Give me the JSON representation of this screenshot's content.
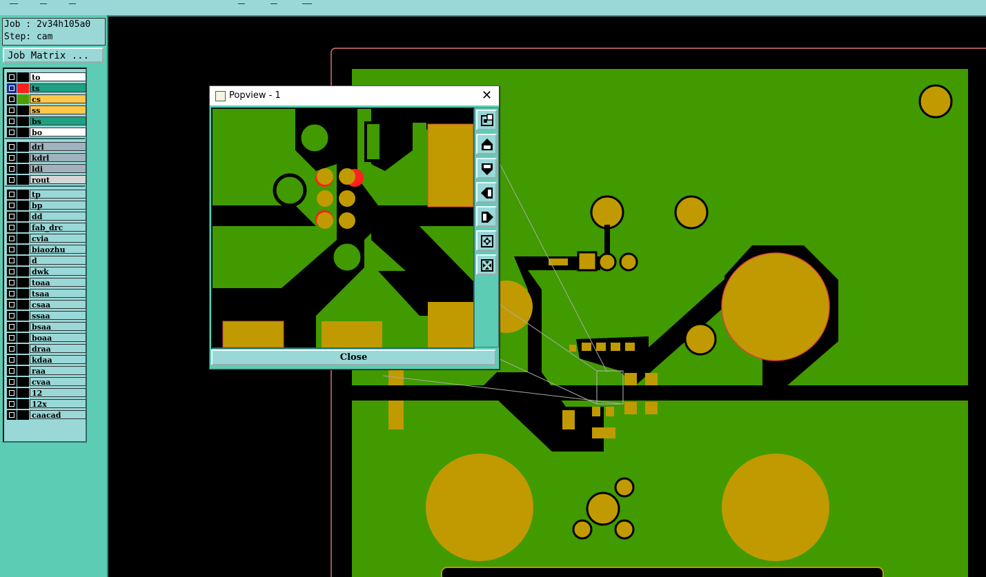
{
  "job": {
    "job_label": "Job : 2v34h105a0",
    "step_label": "Step: cam"
  },
  "job_matrix_label": "Job Matrix ...",
  "layers_board": [
    {
      "name": "to",
      "bg": "#ffffff",
      "selected": false,
      "color": "#000000"
    },
    {
      "name": "ts",
      "bg": "#1fa083",
      "selected": true,
      "color": "#ff2020"
    },
    {
      "name": "cs",
      "bg": "#ffc84a",
      "selected": false,
      "color": "#4aa000"
    },
    {
      "name": "ss",
      "bg": "#ffc84a",
      "selected": false,
      "color": "#000000"
    },
    {
      "name": "bs",
      "bg": "#1fa083",
      "selected": false,
      "color": "#000000"
    },
    {
      "name": "bo",
      "bg": "#ffffff",
      "selected": false,
      "color": "#000000"
    }
  ],
  "layers_drill": [
    {
      "name": "drl",
      "bg": "#9fb2bd"
    },
    {
      "name": "kdrl",
      "bg": "#9fb2bd"
    },
    {
      "name": "ldi",
      "bg": "#9fb2bd"
    },
    {
      "name": "rout",
      "bg": "#d6d6d6"
    }
  ],
  "layers_misc": [
    "tp",
    "bp",
    "dd",
    "fab_drc",
    "cvia",
    "biaozhu",
    "d",
    "dwk",
    "toaa",
    "tsaa",
    "csaa",
    "ssaa",
    "bsaa",
    "boaa",
    "draa",
    "kdaa",
    "raa",
    "cvaa",
    "12",
    "12x",
    "caacad"
  ],
  "popup": {
    "title": "Popview - 1",
    "close_label": "Close",
    "tools": [
      "zoom-fit-icon",
      "pan-up-icon",
      "pan-down-icon",
      "pan-left-icon",
      "pan-right-icon",
      "zoom-in-icon",
      "zoom-out-icon"
    ]
  },
  "colors": {
    "copper": "#409a00",
    "pad": "#c09a00",
    "panel": "#5ccdb4",
    "button": "#9ad8d8"
  }
}
